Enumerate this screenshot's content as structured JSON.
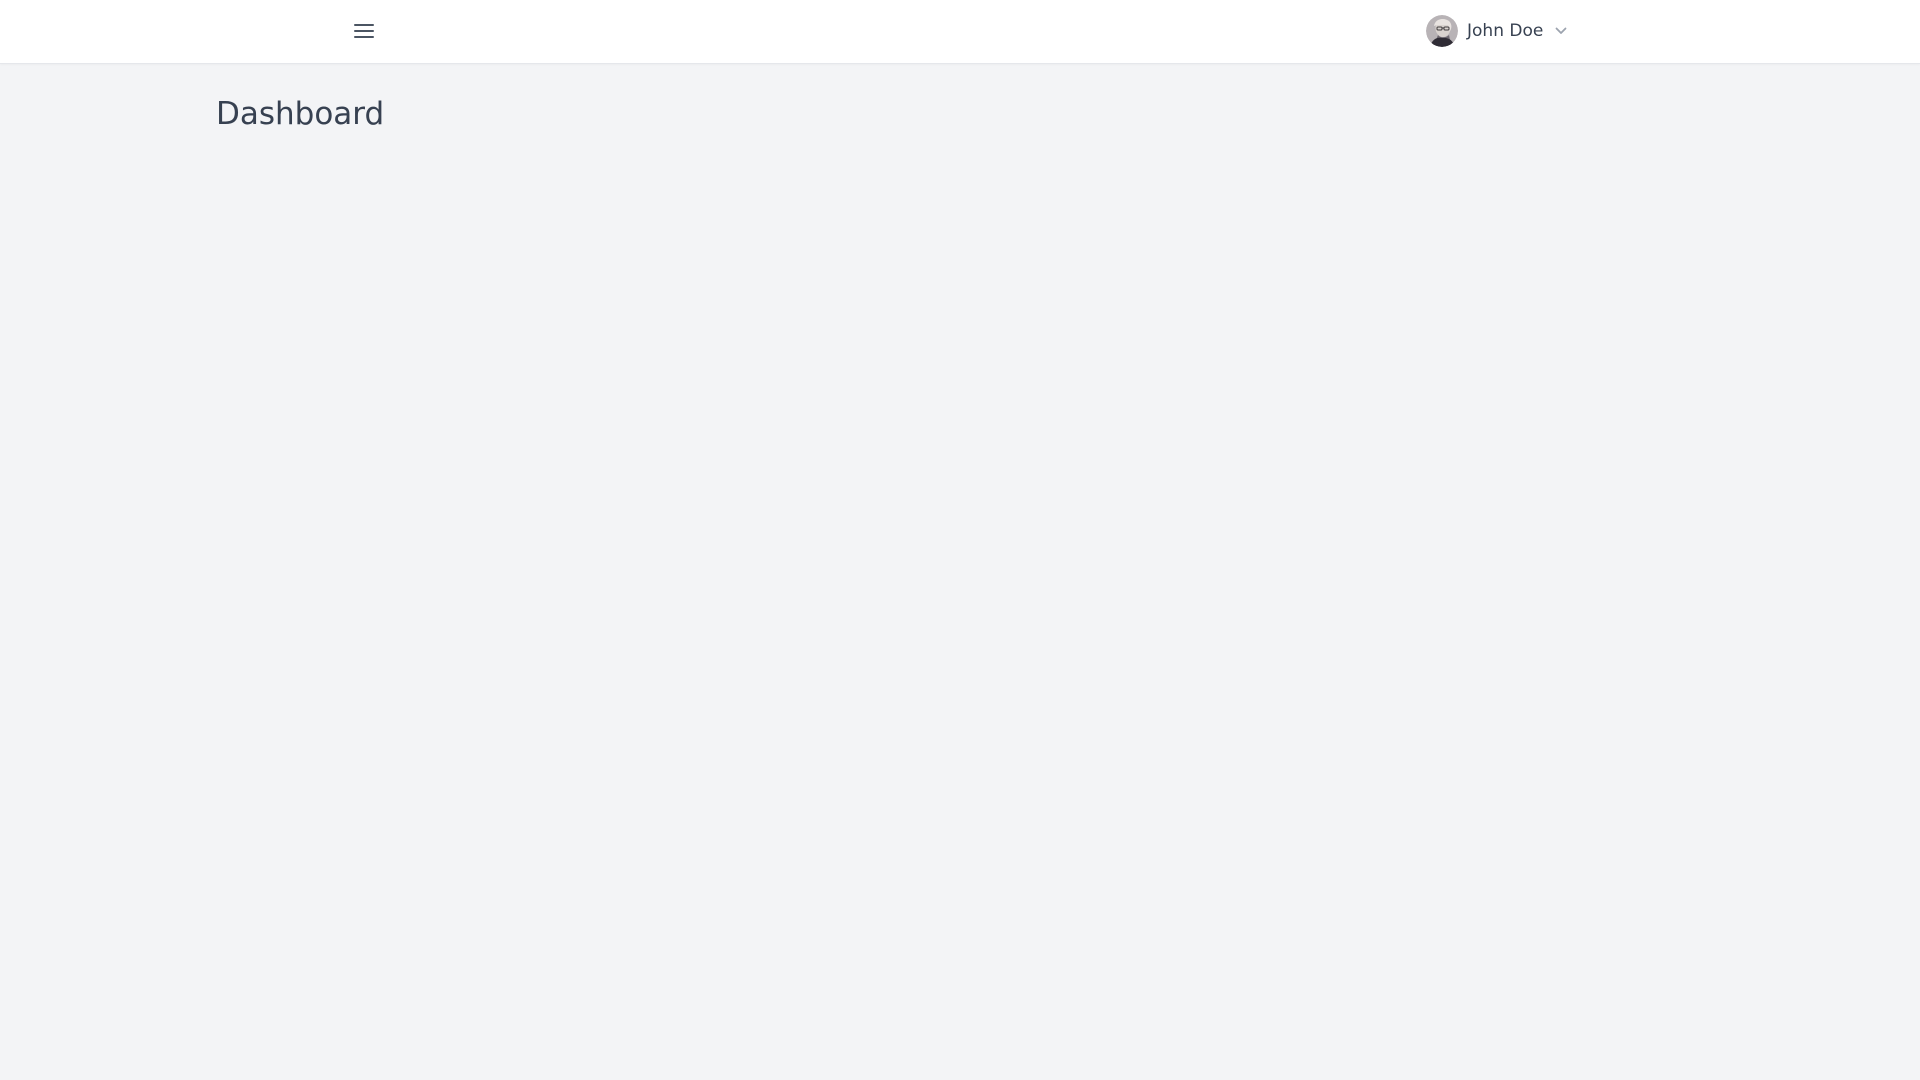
{
  "header": {
    "menu_icon": "hamburger-menu-icon",
    "user": {
      "name": "John Doe",
      "avatar_icon": "user-avatar",
      "dropdown_icon": "chevron-down-icon"
    }
  },
  "main": {
    "title": "Dashboard"
  },
  "colors": {
    "background": "#f3f4f6",
    "header_background": "#ffffff",
    "text": "#374151",
    "muted_icon": "#9ca3af"
  }
}
